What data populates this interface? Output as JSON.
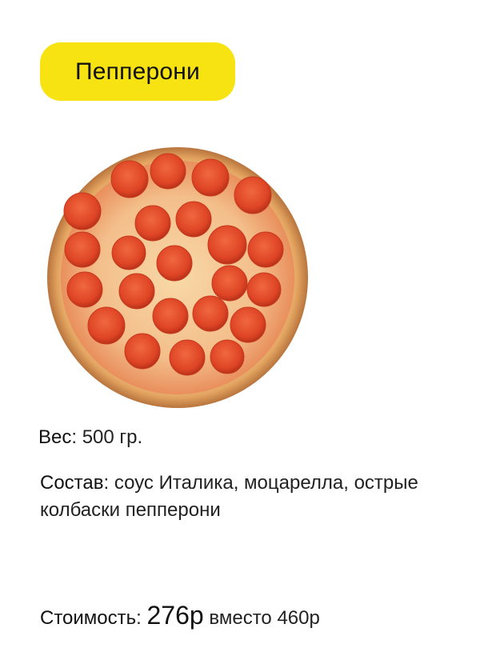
{
  "product": {
    "name": "Пепперони",
    "image": "pepperoni-pizza-photo",
    "weight_label": "Вес",
    "weight_value": "500 гр.",
    "composition_label": "Состав",
    "composition_value": "соус Италика, моцарелла, острые колбаски пепперони",
    "price_label": "Стоимость",
    "price_new": "276р",
    "price_word": "вместо",
    "price_old": "460р"
  },
  "colors": {
    "accent": "#f7e311",
    "crust": "#e9a15a",
    "pepperoni": "#e0462a"
  }
}
